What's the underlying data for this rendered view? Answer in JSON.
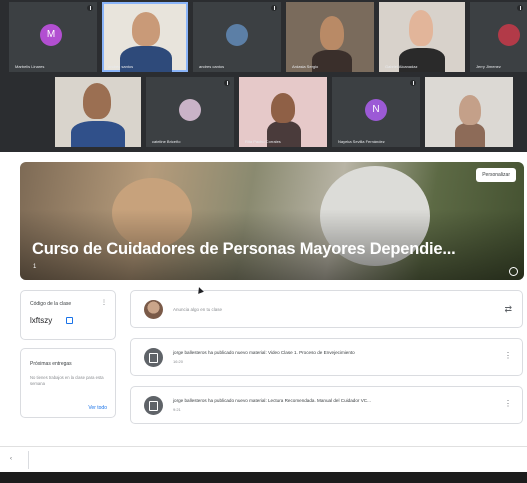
{
  "call": {
    "participants_row1": [
      {
        "name": "Marbelis Linares",
        "initial": "M",
        "color": "#b24fd1"
      },
      {
        "name": "andres santos"
      },
      {
        "name": "andres cantos"
      },
      {
        "name": "Ardasia Sergio"
      },
      {
        "name": "Gabriel Alcanadaz"
      },
      {
        "name": "Jerry Jimenez"
      }
    ],
    "participants_row2": [
      {
        "name": ""
      },
      {
        "name": "cateline Briceño"
      },
      {
        "name": "Rita Pacho Corrales"
      },
      {
        "name": "Nayeka Sevilla Fernández",
        "initial": "N",
        "color": "#9c5ad6"
      },
      {
        "name": ""
      }
    ]
  },
  "classroom": {
    "banner_title": "Curso de Cuidadores de Personas Mayores Dependie...",
    "section": "1",
    "personalize_label": "Personalizar",
    "class_code_label": "Código de la clase",
    "class_code": "lxftszy",
    "upcoming_label": "Próximas entregas",
    "upcoming_text": "No tienes trabajos en la clase para esta semana",
    "view_all_label": "Ver todo",
    "announce_placeholder": "Anuncia algo en tu clase",
    "posts": [
      {
        "text": "jorge ballesteros ha publicado nuevo material: Video Clase 1. Proceso de Envejecimiento",
        "date": "16:20"
      },
      {
        "text": "jorge ballesteros ha publicado nuevo material: Lectura Recomendada. Manual del Cuidador VC...",
        "date": "9:21"
      }
    ]
  }
}
